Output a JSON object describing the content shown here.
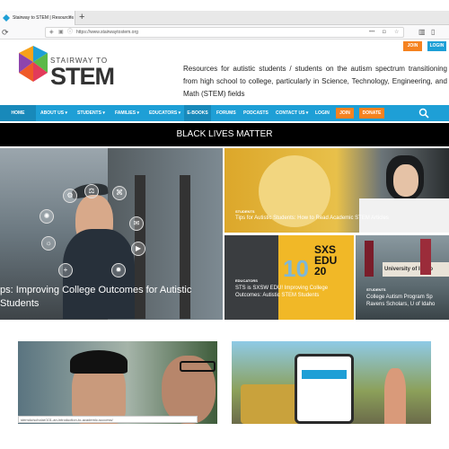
{
  "browser": {
    "tab_title": "Stairway to STEM | Resources",
    "url": "https://www.stairwaytostem.org"
  },
  "header": {
    "join_label": "JOIN",
    "login_label": "LOGIN",
    "logo_line1": "STAIRWAY TO",
    "logo_line2": "STEM",
    "tagline": "Resources for autistic students / students on the autism spectrum transitioning from high school to college, particularly in Science, Technology, Engineering, and Math (STEM) fields"
  },
  "nav": {
    "items": [
      "HOME",
      "ABOUT US",
      "STUDENTS",
      "FAMILIES",
      "EDUCATORS",
      "E-BOOKS",
      "FORUMS",
      "PODCASTS",
      "CONTACT US",
      "LOGIN"
    ],
    "join_label": "JOIN",
    "donate_label": "DONATE"
  },
  "banner": "BLACK LIVES MATTER",
  "cards": {
    "main_title": "ps: Improving College Outcomes for Autistic Students",
    "card1": {
      "kicker": "STUDENTS",
      "title": "Tips for Autistic Students: How to Read Academic STEM Articles"
    },
    "card2": {
      "kicker": "EDUCATORS",
      "title": "STS is SXSW EDU! Improving College Outcomes: Autistic STEM Students",
      "poster_text": "SXS EDU 20",
      "poster_num": "10"
    },
    "card3": {
      "kicker": "STUDENTS",
      "title": "College Autism Program Sp Ravens Scholars, U of Idaho",
      "sign_text": "University of Idaho"
    }
  },
  "status_url": "stemdu/scholar/101-an-introduction-to-academic-success/",
  "colors": {
    "nav": "#1e9fd6",
    "join": "#f58220",
    "login": "#1e9fd6",
    "donate": "#f58220"
  }
}
